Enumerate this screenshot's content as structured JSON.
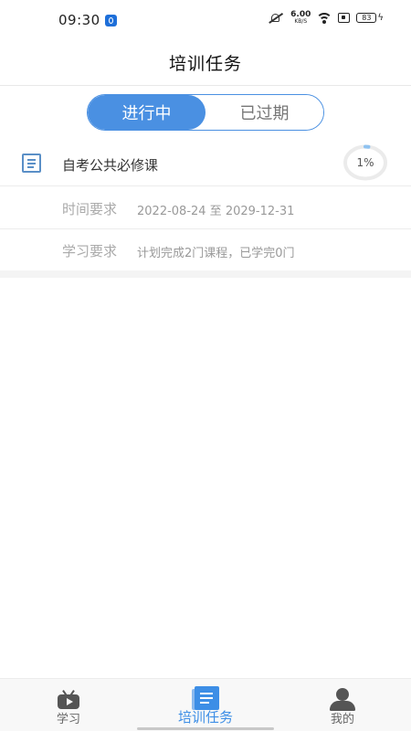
{
  "status_bar": {
    "time": "09:30",
    "net_speed_value": "6.00",
    "net_speed_unit": "KB/S",
    "battery": "83"
  },
  "header": {
    "title": "培训任务"
  },
  "segment": {
    "active_label": "进行中",
    "inactive_label": "已过期"
  },
  "task": {
    "title": "自考公共必修课",
    "progress_text": "1%",
    "progress": 0.01,
    "time_label": "时间要求",
    "time_value": "2022-08-24 至 2029-12-31",
    "study_label": "学习要求",
    "study_value": "计划完成2门课程，已学完0门"
  },
  "tabbar": {
    "items": [
      {
        "label": "学习",
        "icon": "tv-icon"
      },
      {
        "label": "培训任务",
        "icon": "book-icon"
      },
      {
        "label": "我的",
        "icon": "user-icon"
      }
    ],
    "active_color": "#3d8ee6"
  },
  "colors": {
    "accent": "#4a90e2"
  }
}
